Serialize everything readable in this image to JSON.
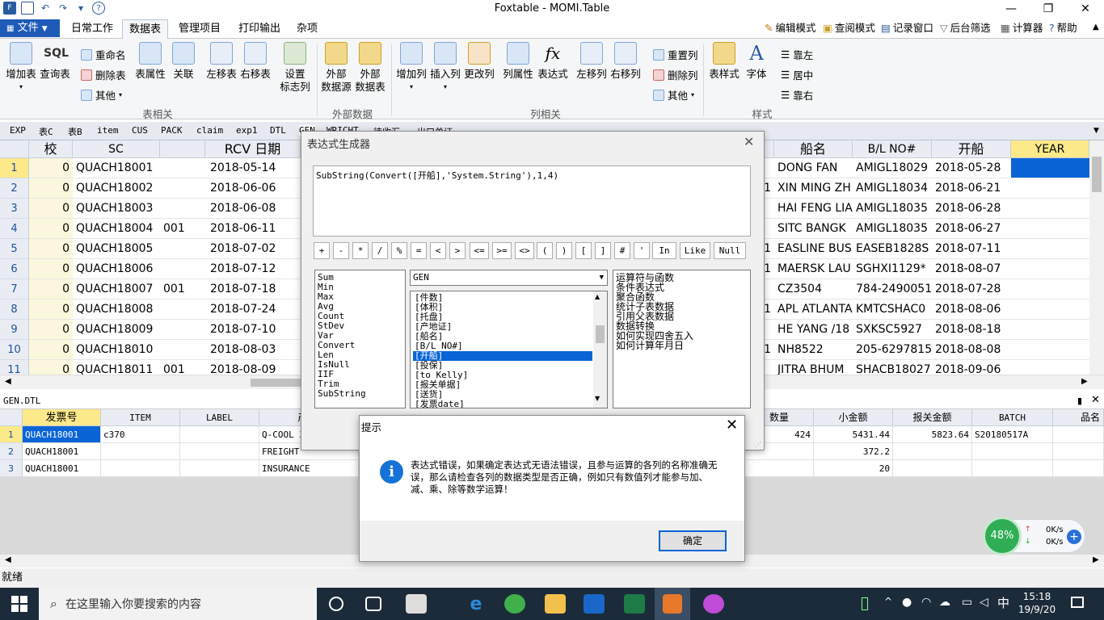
{
  "window": {
    "title": "Foxtable - MOMI.Table",
    "controls": [
      "—",
      "❐",
      "✕"
    ]
  },
  "menu": {
    "file_label": "文件",
    "tabs": [
      "日常工作",
      "数据表",
      "管理项目",
      "打印输出",
      "杂项"
    ],
    "active_tab": "数据表",
    "right_tools": [
      "编辑模式",
      "查阅模式",
      "记录窗口",
      "后台筛选",
      "计算器",
      "帮助"
    ]
  },
  "ribbon": {
    "buttons": {
      "add_table": "增加表",
      "query_table": "查询表",
      "table_props": "表属性",
      "relations": "关联",
      "left_move_table": "左移表",
      "right_move_table": "右移表",
      "set_title_col_1": "设置",
      "set_title_col_2": "标志列",
      "ext_source_1": "外部",
      "ext_source_2": "数据源",
      "ext_table_1": "外部",
      "ext_table_2": "数据表",
      "add_col": "增加列",
      "insert_col": "插入列",
      "change_col": "更改列",
      "col_props": "列属性",
      "expression": "表达式",
      "left_move_col": "左移列",
      "right_move_col": "右移列",
      "table_style": "表样式",
      "font": "字体"
    },
    "small": {
      "rename": "重命名",
      "delete_table": "删除表",
      "other1": "其他",
      "reset_col": "重置列",
      "delete_col": "删除列",
      "other2": "其他",
      "align_left": "靠左",
      "align_center": "居中",
      "align_right": "靠右"
    },
    "groups": {
      "table": "表相关",
      "external": "外部数据",
      "column": "列相关",
      "style": "样式"
    },
    "sql_label": "SQL",
    "fx_label": "fx"
  },
  "sheet_tabs": [
    "EXP",
    "表C",
    "表B",
    "item",
    "CUS",
    "PACK",
    "claim",
    "exp1",
    "DTL",
    "GEN",
    "WRICHT",
    "待收汇",
    "出口单证"
  ],
  "grid1": {
    "headers": {
      "jiao": "校",
      "sc": "SC",
      "rcv": "RCV 日期",
      "ship": "船名",
      "bl": "B/L NO#",
      "sail": "开船",
      "year": "YEAR"
    },
    "rows": [
      {
        "n": "1",
        "jiao": "0",
        "sc": "QUACH18001",
        "mid": "",
        "rcv": "2018-05-14",
        "one": "",
        "ship": "DONG FAN",
        "bl": "AMIGL18029",
        "sail": "2018-05-28"
      },
      {
        "n": "2",
        "jiao": "0",
        "sc": "QUACH18002",
        "mid": "",
        "rcv": "2018-06-06",
        "one": "1",
        "ship": "XIN MING ZH",
        "bl": "AMIGL18034",
        "sail": "2018-06-21"
      },
      {
        "n": "3",
        "jiao": "0",
        "sc": "QUACH18003",
        "mid": "",
        "rcv": "2018-06-08",
        "one": "",
        "ship": "HAI FENG LIA",
        "bl": "AMIGL18035",
        "sail": "2018-06-28"
      },
      {
        "n": "4",
        "jiao": "0",
        "sc": "QUACH18004",
        "mid": "001",
        "rcv": "2018-06-11",
        "one": "",
        "ship": "SITC BANGK",
        "bl": "AMIGL18035",
        "sail": "2018-06-27"
      },
      {
        "n": "5",
        "jiao": "0",
        "sc": "QUACH18005",
        "mid": "",
        "rcv": "2018-07-02",
        "one": "1",
        "ship": "EASLINE BUS",
        "bl": "EASEB1828S",
        "sail": "2018-07-11"
      },
      {
        "n": "6",
        "jiao": "0",
        "sc": "QUACH18006",
        "mid": "",
        "rcv": "2018-07-12",
        "one": "1",
        "ship": "MAERSK LAU",
        "bl": "SGHXI1129*",
        "sail": "2018-08-07"
      },
      {
        "n": "7",
        "jiao": "0",
        "sc": "QUACH18007",
        "mid": "001",
        "rcv": "2018-07-18",
        "one": "",
        "ship": "CZ3504",
        "bl": "784-2490051",
        "sail": "2018-07-28"
      },
      {
        "n": "8",
        "jiao": "0",
        "sc": "QUACH18008",
        "mid": "",
        "rcv": "2018-07-24",
        "one": "1",
        "ship": "APL ATLANTA",
        "bl": "KMTCSHAC0",
        "sail": "2018-08-06"
      },
      {
        "n": "9",
        "jiao": "0",
        "sc": "QUACH18009",
        "mid": "",
        "rcv": "2018-07-10",
        "one": "",
        "ship": "HE YANG /18",
        "bl": "SXKSC5927",
        "sail": "2018-08-18"
      },
      {
        "n": "10",
        "jiao": "0",
        "sc": "QUACH18010",
        "mid": "",
        "rcv": "2018-08-03",
        "one": "1",
        "ship": "NH8522",
        "bl": "205-6297815",
        "sail": "2018-08-08"
      },
      {
        "n": "11",
        "jiao": "0",
        "sc": "QUACH18011",
        "mid": "001",
        "rcv": "2018-08-09",
        "one": "",
        "ship": "JITRA BHUM",
        "bl": "SHACB18027",
        "sail": "2018-09-06"
      }
    ]
  },
  "panel2": {
    "title": "GEN.DTL",
    "headers": [
      "发票号",
      "ITEM",
      "LABEL",
      "产品",
      "数量",
      "小金额",
      "报关金额",
      "BATCH",
      "品名"
    ],
    "rows": [
      {
        "n": "1",
        "inv": "QUACH18001",
        "item": "c370",
        "label": "",
        "prod": "Q-COOL 3",
        "qty": "424",
        "amt": "5431.44",
        "decl": "5823.64",
        "batch": "S20180517A"
      },
      {
        "n": "2",
        "inv": "QUACH18001",
        "item": "",
        "label": "",
        "prod": "FREIGHT",
        "qty": "",
        "amt": "372.2",
        "decl": "",
        "batch": ""
      },
      {
        "n": "3",
        "inv": "QUACH18001",
        "item": "",
        "label": "",
        "prod": "INSURANCE",
        "qty": "",
        "amt": "20",
        "decl": "",
        "batch": ""
      }
    ]
  },
  "status": "就绪",
  "taskbar": {
    "search_placeholder": "在这里输入你要搜索的内容",
    "time": "15:18",
    "date": "19/9/20",
    "ime": "中"
  },
  "expr_dialog": {
    "title": "表达式生成器",
    "expression": "SubString(Convert([开船],'System.String'),1,4)",
    "operators": [
      "+",
      "-",
      "*",
      "/",
      "%",
      "=",
      "<",
      ">",
      "<=",
      ">=",
      "<>",
      "(",
      ")",
      "[",
      "]",
      "#",
      "'",
      "In",
      "Like",
      "Null"
    ],
    "functions": [
      "Sum",
      "Min",
      "Max",
      "Avg",
      "Count",
      "StDev",
      "Var",
      "Convert",
      "Len",
      "IsNull",
      "IIF",
      "Trim",
      "SubString"
    ],
    "table_selected": "GEN",
    "columns": [
      "[件数]",
      "[体积]",
      "[托盘]",
      "[产地证]",
      "[船名]",
      "[B/L NO#]",
      "[开船]",
      "[投保]",
      "[to Kelly]",
      "[报关单据]",
      "[送货]",
      "[发票date]"
    ],
    "selected_column": "[开船]",
    "help_items": [
      "运算符与函数",
      "条件表达式",
      "聚合函数",
      "统计子表数据",
      "引用父表数据",
      "数据转换",
      "如何实现四舍五入",
      "如何计算年月日"
    ]
  },
  "msg_dialog": {
    "title": "提示",
    "text": "表达式错误，如果确定表达式无语法错误，且参与运算的各列的名称准确无误，那么请检查各列的数据类型是否正确，例如只有数值列才能参与加、减、乘、除等数学运算！",
    "ok_label": "确定"
  },
  "net_widget": {
    "percent": "48%",
    "up": "0K/s",
    "down": "0K/s"
  },
  "colors": {
    "accent": "#1e5bb8",
    "selection": "#0a64d6",
    "year_header": "#fce98a",
    "taskbar": "#1c2b3a"
  }
}
